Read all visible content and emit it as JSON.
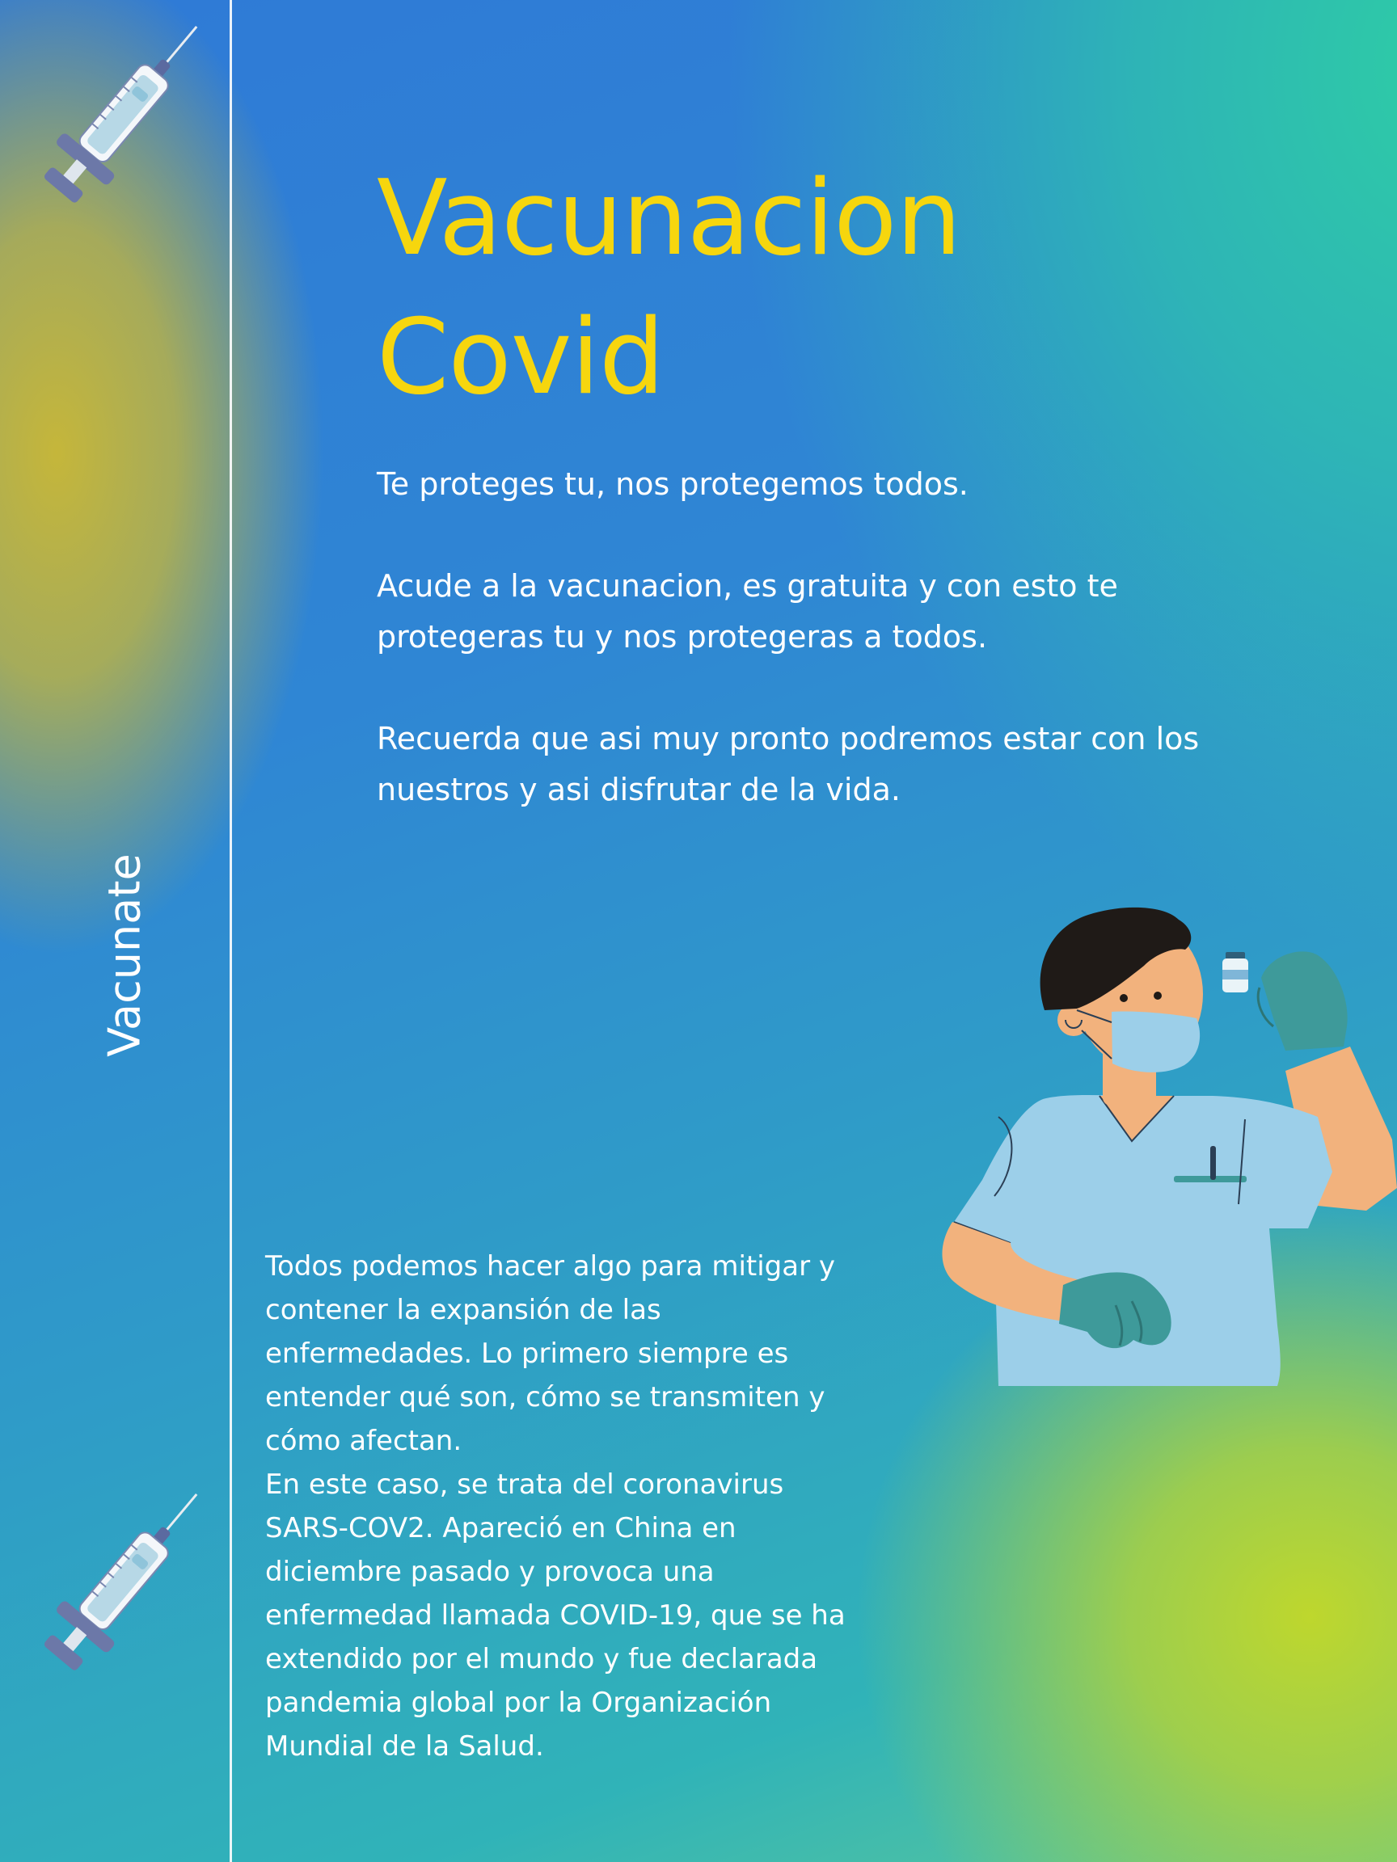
{
  "poster": {
    "title_line1": "Vacunacion",
    "title_line2": "Covid",
    "side_label": "Vacunate",
    "intro": [
      "Te proteges tu, nos protegemos todos.",
      "Acude a la vacunacion, es gratuita y con esto te protegeras tu y nos protegeras a todos.",
      "Recuerda que asi muy pronto podremos estar con los nuestros y asi disfrutar de la vida."
    ],
    "body": [
      "Todos podemos hacer algo para mitigar y contener la expansión de las enfermedades. Lo primero siempre es entender qué son, cómo se transmiten y cómo afectan.",
      "En este caso, se trata del coronavirus SARS-COV2. Apareció en China en diciembre pasado y provoca una enfermedad llamada COVID-19, que se ha extendido por el mundo y fue declarada pandemia global por la Organización Mundial de la Salud."
    ]
  },
  "colors": {
    "title": "#f6d60e",
    "text": "#ffffff",
    "blue": "#2f6fdc",
    "teal": "#2ecba8",
    "yellow_green": "#bcd63a"
  },
  "icons": [
    "syringe-icon",
    "syringe-icon",
    "nurse-illustration",
    "vaccine-vial-icon"
  ]
}
